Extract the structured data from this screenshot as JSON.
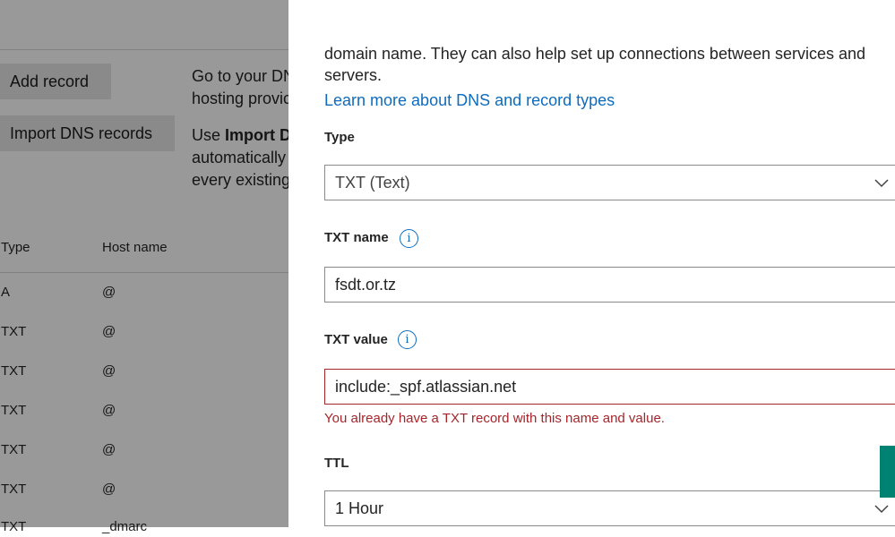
{
  "background": {
    "buttons": {
      "add_record": "Add record",
      "import_dns": "Import DNS records"
    },
    "desc1": {
      "line1": "Go to your DN",
      "line2": "hosting provic"
    },
    "desc2": {
      "prefix": "Use ",
      "bold": "Import D",
      "line2": "automatically",
      "line3": "every existing"
    },
    "table": {
      "headers": {
        "type": "Type",
        "host": "Host name"
      },
      "rows": [
        {
          "type": "A",
          "host": "@"
        },
        {
          "type": "TXT",
          "host": "@"
        },
        {
          "type": "TXT",
          "host": "@"
        },
        {
          "type": "TXT",
          "host": "@"
        },
        {
          "type": "TXT",
          "host": "@"
        },
        {
          "type": "TXT",
          "host": "@"
        },
        {
          "type": "TXT",
          "host": "_dmarc"
        }
      ]
    }
  },
  "panel": {
    "intro_line1": "domain name. They can also help set up connections between services and",
    "intro_line2": "servers.",
    "learn_more": "Learn more about DNS and record types",
    "type_label": "Type",
    "type_value": "TXT (Text)",
    "txt_name_label": "TXT name",
    "txt_name_value": "fsdt.or.tz",
    "txt_value_label": "TXT value",
    "txt_value_value": "include:_spf.atlassian.net",
    "error_message": "You already have a TXT record with this name and value.",
    "ttl_label": "TTL",
    "ttl_value": "1 Hour",
    "info_icon_glyph": "i"
  },
  "colors": {
    "link": "#0f6cbd",
    "error": "#a4262c",
    "teal": "#008272"
  }
}
